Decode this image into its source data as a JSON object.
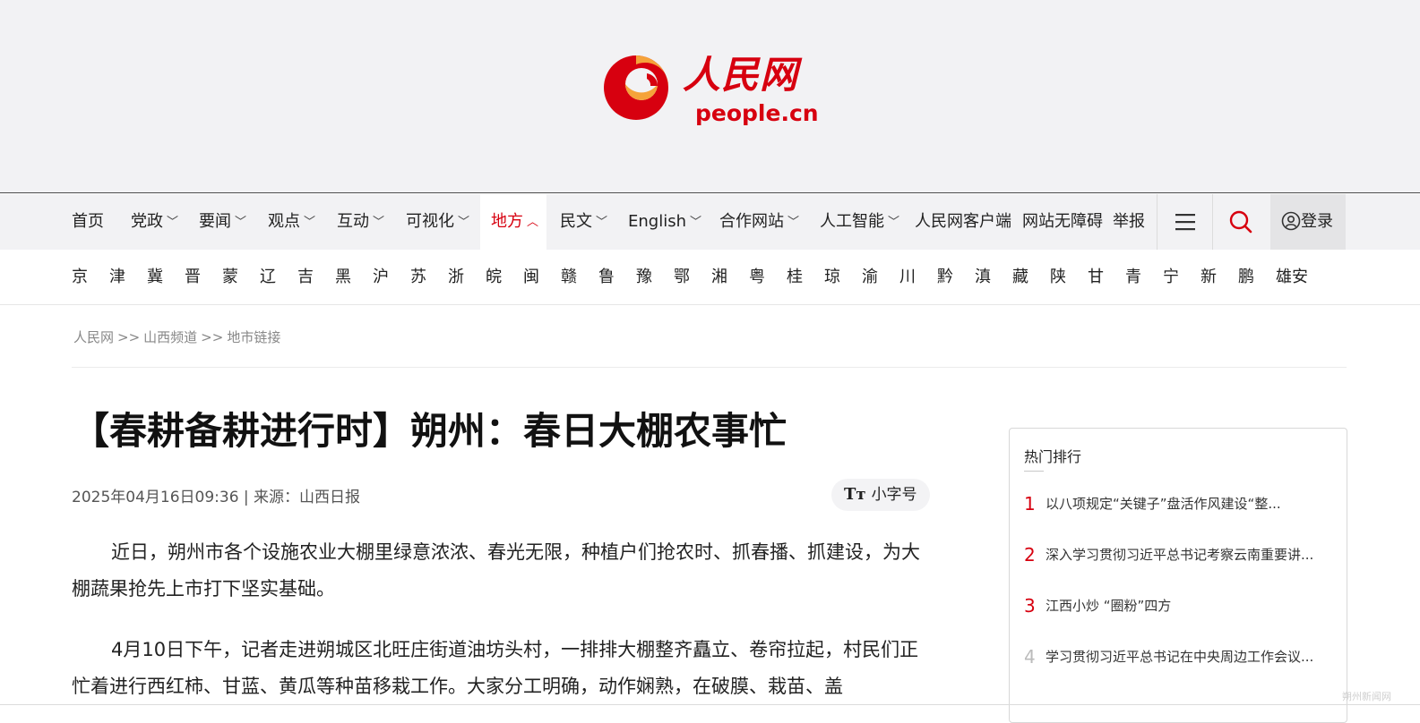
{
  "brand": {
    "name": "人民网",
    "domain": "people.cn",
    "colors": {
      "red": "#d7000f",
      "orange": "#f5a33a",
      "header_bg": "#f2f2f4"
    }
  },
  "nav": {
    "items": [
      {
        "label": "首页",
        "has_dropdown": false
      },
      {
        "label": "党政",
        "has_dropdown": true
      },
      {
        "label": "要闻",
        "has_dropdown": true
      },
      {
        "label": "观点",
        "has_dropdown": true
      },
      {
        "label": "互动",
        "has_dropdown": true
      },
      {
        "label": "可视化",
        "has_dropdown": true
      },
      {
        "label": "地方",
        "has_dropdown": true,
        "active": true
      },
      {
        "label": "民文",
        "has_dropdown": true
      },
      {
        "label": "English",
        "has_dropdown": true
      },
      {
        "label": "合作网站",
        "has_dropdown": true
      },
      {
        "label": "人工智能",
        "has_dropdown": true
      },
      {
        "label": "人民网客户端",
        "has_dropdown": false
      },
      {
        "label": "网站无障碍",
        "has_dropdown": false
      },
      {
        "label": "举报",
        "has_dropdown": false
      }
    ],
    "menu_icon": "hamburger-icon",
    "search_icon": "search-icon",
    "login_label": "登录",
    "login_icon": "user-circle-icon"
  },
  "regions": [
    "京",
    "津",
    "冀",
    "晋",
    "蒙",
    "辽",
    "吉",
    "黑",
    "沪",
    "苏",
    "浙",
    "皖",
    "闽",
    "赣",
    "鲁",
    "豫",
    "鄂",
    "湘",
    "粤",
    "桂",
    "琼",
    "渝",
    "川",
    "黔",
    "滇",
    "藏",
    "陕",
    "甘",
    "青",
    "宁",
    "新",
    "鹏",
    "雄安"
  ],
  "breadcrumb": {
    "items": [
      "人民网",
      "山西频道",
      "地市链接"
    ],
    "separator": ">>"
  },
  "article": {
    "title": "【春耕备耕进行时】朔州：春日大棚农事忙",
    "meta": "2025年04月16日09:36 | 来源：山西日报",
    "font_toggle_label": "小字号",
    "font_toggle_icon_text": "Tт",
    "paragraphs": [
      "近日，朔州市各个设施农业大棚里绿意浓浓、春光无限，种植户们抢农时、抓春播、抓建设，为大棚蔬果抢先上市打下坚实基础。",
      "4月10日下午，记者走进朔城区北旺庄街道油坊头村，一排排大棚整齐矗立、卷帘拉起，村民们正忙着进行西红柿、甘蓝、黄瓜等种苗移栽工作。大家分工明确，动作娴熟，在破膜、栽苗、盖"
    ]
  },
  "hot": {
    "title": "热门排行",
    "items": [
      {
        "rank": "1",
        "text": "以八项规定“关键子”盘活作风建设“整..."
      },
      {
        "rank": "2",
        "text": "深入学习贯彻习近平总书记考察云南重要讲..."
      },
      {
        "rank": "3",
        "text": "江西小炒 “圈粉”四方"
      },
      {
        "rank": "4",
        "text": "学习贯彻习近平总书记在中央周边工作会议..."
      }
    ]
  },
  "watermark": "朔州新闻网"
}
